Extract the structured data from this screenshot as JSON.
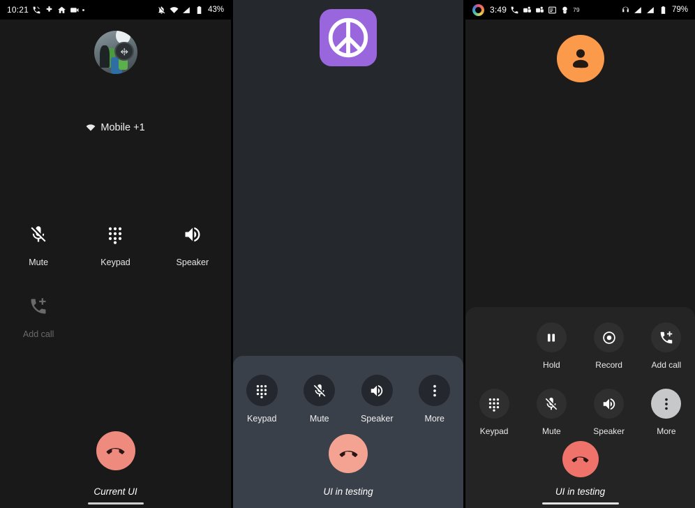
{
  "panels": [
    {
      "id": "current-ui",
      "caption": "Current UI",
      "status_bar": {
        "time": "10:21",
        "left_icons": [
          "phone-call-icon",
          "fitness-icon",
          "home-icon",
          "video-icon",
          "dot-icon"
        ],
        "right_icons": [
          "notification-off-icon",
          "wifi-icon",
          "signal-icon",
          "battery-icon"
        ],
        "battery": "43%"
      },
      "avatar": "contact-photo-avatar",
      "subtitle": "Mobile +1",
      "subtitle_icon": "wifi-calling-icon",
      "buttons": [
        {
          "label": "Mute",
          "icon": "mic-off-icon",
          "state": "enabled"
        },
        {
          "label": "Keypad",
          "icon": "dialpad-icon",
          "state": "enabled"
        },
        {
          "label": "Speaker",
          "icon": "volume-up-icon",
          "state": "enabled"
        },
        {
          "label": "Add call",
          "icon": "add-call-icon",
          "state": "disabled"
        }
      ],
      "end_call": {
        "label": "End call",
        "icon": "call-end-icon",
        "color": "#EE8B7E"
      }
    },
    {
      "id": "ui-in-testing-a",
      "caption": "UI in testing",
      "avatar": "peace-sign-avatar",
      "avatar_color": "#9966DD",
      "buttons": [
        {
          "label": "Keypad",
          "icon": "dialpad-icon",
          "state": "enabled"
        },
        {
          "label": "Mute",
          "icon": "mic-off-icon",
          "state": "enabled"
        },
        {
          "label": "Speaker",
          "icon": "volume-up-icon",
          "state": "enabled"
        },
        {
          "label": "More",
          "icon": "more-vert-icon",
          "state": "enabled"
        }
      ],
      "end_call": {
        "label": "End call",
        "icon": "call-end-icon",
        "color": "#F4A393"
      }
    },
    {
      "id": "ui-in-testing-b",
      "caption": "UI in testing",
      "status_bar": {
        "time": "3:49",
        "leading_icon": "activity-ring-icon",
        "left_icons": [
          "phone-call-icon",
          "teams-icon",
          "teams-icon",
          "list-icon",
          "alert-icon"
        ],
        "left_badge": "79",
        "right_icons": [
          "headset-icon",
          "signal-icon",
          "signal-icon",
          "battery-icon"
        ],
        "battery": "79%"
      },
      "avatar": "person-avatar",
      "avatar_color": "#FB9A4B",
      "buttons_row1": [
        {
          "label": "Hold",
          "icon": "pause-icon",
          "state": "enabled"
        },
        {
          "label": "Record",
          "icon": "record-icon",
          "state": "enabled"
        },
        {
          "label": "Add call",
          "icon": "add-call-icon",
          "state": "enabled"
        }
      ],
      "buttons_row2": [
        {
          "label": "Keypad",
          "icon": "dialpad-icon",
          "state": "enabled"
        },
        {
          "label": "Mute",
          "icon": "mic-off-icon",
          "state": "enabled"
        },
        {
          "label": "Speaker",
          "icon": "volume-up-icon",
          "state": "enabled"
        },
        {
          "label": "More",
          "icon": "more-vert-icon",
          "state": "selected"
        }
      ],
      "end_call": {
        "label": "End call",
        "icon": "call-end-icon",
        "color": "#F0736B"
      }
    }
  ]
}
